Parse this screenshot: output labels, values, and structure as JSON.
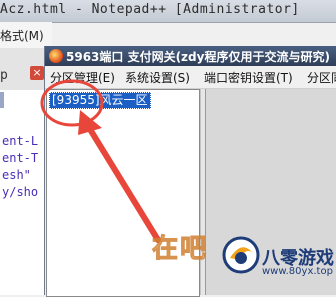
{
  "background_window": {
    "title": "Acz.html - Notepad++ [Administrator]",
    "menu_fragment": "格式(M)",
    "tab_fragment": "p",
    "tab_close": "×",
    "code_lines": [
      "ent-L",
      "ent-T",
      "esh\"",
      "y/sho"
    ]
  },
  "app_window": {
    "title": "5963端口 支付网关(zdy程序仅用于交流与研究)",
    "menu": [
      "分区管理(E)",
      "系统设置(S)",
      "端口密钥设置(T)",
      "分区同"
    ],
    "tree_items": [
      "[93955]风云一区"
    ]
  },
  "watermark": {
    "logo_text": "在吧",
    "name": "八零游戏",
    "url": "www.80yx.top"
  },
  "colors": {
    "annotation": "#e8463a",
    "selection": "#1c5fc4",
    "titlebar": "#2e3e58"
  }
}
